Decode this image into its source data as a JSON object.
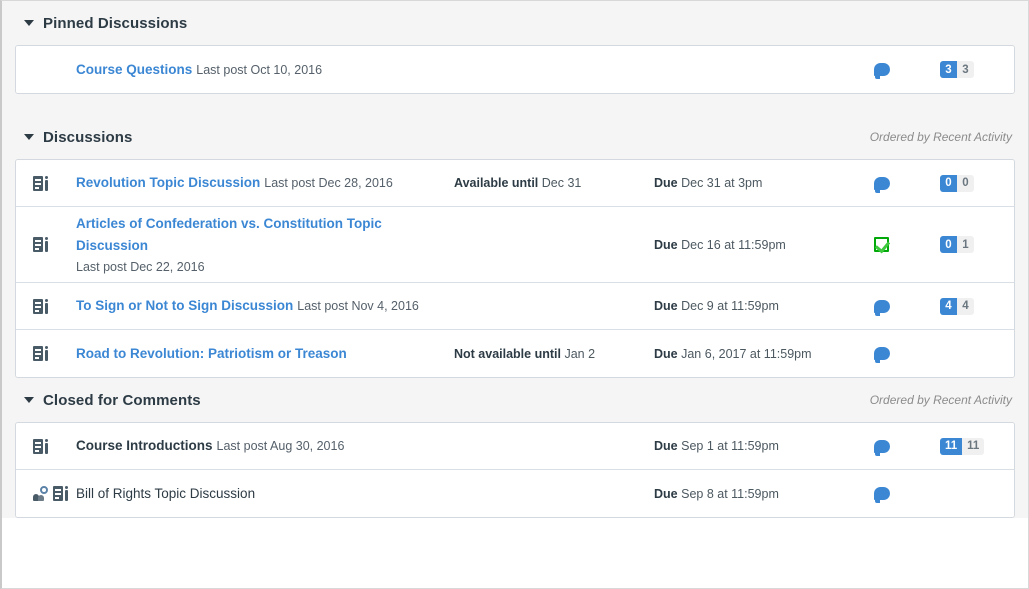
{
  "sections": [
    {
      "id": "pinned",
      "title": "Pinned Discussions",
      "meta": "",
      "rows": [
        {
          "icon": "none",
          "indent": true,
          "title": "Course Questions",
          "title_style": "link",
          "last_post": "Last post Oct 10, 2016",
          "available_label": "",
          "available_value": "",
          "due_label": "",
          "due_value": "",
          "status_icon": "bubble-icon",
          "unread": "3",
          "total": "3"
        }
      ]
    },
    {
      "id": "discussions",
      "title": "Discussions",
      "meta": "Ordered by Recent Activity",
      "rows": [
        {
          "icon": "discussion-icon",
          "indent": false,
          "title": "Revolution Topic Discussion",
          "title_style": "link",
          "last_post": "Last post Dec 28, 2016",
          "available_label": "Available until",
          "available_value": "Dec 31",
          "due_label": "Due",
          "due_value": "Dec 31 at 3pm",
          "status_icon": "bubble-icon",
          "unread": "0",
          "total": "0"
        },
        {
          "icon": "discussion-icon",
          "indent": false,
          "title": "Articles of Confederation vs. Constitution Topic Discussion",
          "title_style": "link",
          "last_post": "Last post Dec 22, 2016",
          "last_post_block": true,
          "available_label": "",
          "available_value": "",
          "due_label": "Due",
          "due_value": "Dec 16 at 11:59pm",
          "status_icon": "graded-check-icon",
          "unread": "0",
          "total": "1"
        },
        {
          "icon": "discussion-icon",
          "indent": false,
          "title": "To Sign or Not to Sign Discussion",
          "title_style": "link",
          "last_post": "Last post Nov 4, 2016",
          "available_label": "",
          "available_value": "",
          "due_label": "Due",
          "due_value": "Dec 9 at 11:59pm",
          "status_icon": "bubble-icon",
          "unread": "4",
          "total": "4"
        },
        {
          "icon": "discussion-icon",
          "indent": false,
          "title": "Road to Revolution: Patriotism or Treason",
          "title_style": "link",
          "last_post": "",
          "available_label": "Not available until",
          "available_value": "Jan 2",
          "due_label": "Due",
          "due_value": "Jan 6, 2017 at 11:59pm",
          "status_icon": "bubble-icon",
          "unread": "",
          "total": ""
        }
      ]
    },
    {
      "id": "closed",
      "title": "Closed for Comments",
      "meta": "Ordered by Recent Activity",
      "rows": [
        {
          "icon": "discussion-icon",
          "indent": false,
          "title": "Course Introductions",
          "title_style": "plain",
          "last_post": "Last post Aug 30, 2016",
          "available_label": "",
          "available_value": "",
          "due_label": "Due",
          "due_value": "Sep 1 at 11:59pm",
          "status_icon": "bubble-icon",
          "unread": "11",
          "total": "11"
        },
        {
          "icon": "group-discussion-icon",
          "indent": false,
          "title": "Bill of Rights Topic Discussion",
          "title_style": "plain-light",
          "last_post": "",
          "available_label": "",
          "available_value": "",
          "due_label": "Due",
          "due_value": "Sep 8 at 11:59pm",
          "status_icon": "bubble-icon",
          "unread": "",
          "total": ""
        }
      ]
    }
  ],
  "colors": {
    "link": "#3b87d4",
    "badge_unread_bg": "#3b87d4",
    "badge_total_bg": "#f0f0f0",
    "graded_green": "#00a80a",
    "section_bg": "#f5f5f5",
    "text_dark": "#2d3b45"
  }
}
